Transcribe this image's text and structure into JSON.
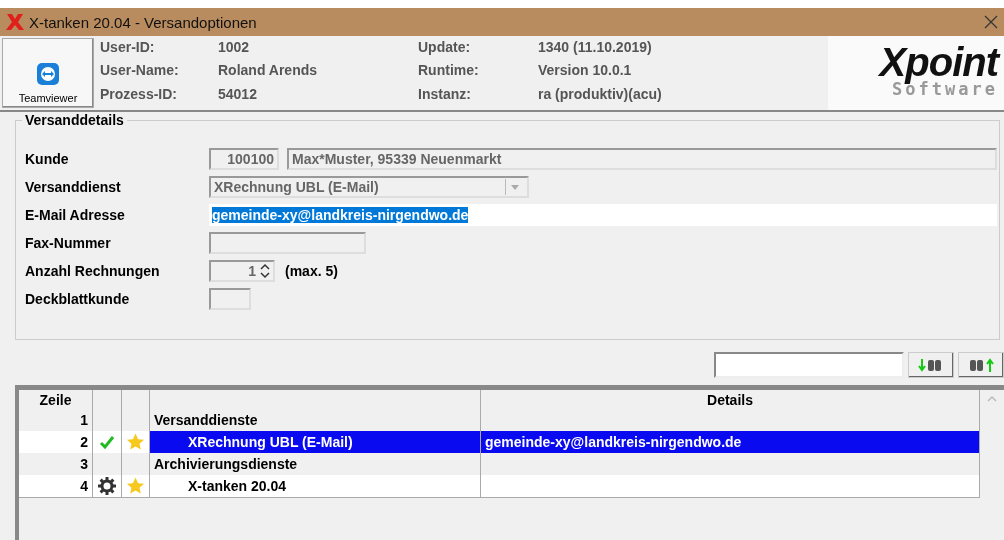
{
  "window": {
    "title": "X-tanken 20.04  - Versandoptionen"
  },
  "header": {
    "teamviewer_button": "Teamviewer",
    "info_left": [
      {
        "label": "User-ID:",
        "value": "1002"
      },
      {
        "label": "User-Name:",
        "value": "Roland Arends"
      },
      {
        "label": "Prozess-ID:",
        "value": "54012"
      }
    ],
    "info_right": [
      {
        "label": "Update:",
        "value": "1340 (11.10.2019)"
      },
      {
        "label": "Runtime:",
        "value": "Version 10.0.1"
      },
      {
        "label": "Instanz:",
        "value": "ra (produktiv)(acu)"
      }
    ],
    "logo": {
      "brand": "Xpoint",
      "tagline": "Software"
    }
  },
  "details": {
    "title": "Versanddetails",
    "rows": [
      {
        "label": "Kunde",
        "kind": "pair",
        "values": [
          "100100",
          "Max*Muster, 95339 Neuenmarkt"
        ]
      },
      {
        "label": "Versanddienst",
        "kind": "dropdown",
        "value": "XRechnung UBL (E-Mail)",
        "disabled": true
      },
      {
        "label": "E-Mail Adresse",
        "kind": "text",
        "value": "gemeinde-xy@landkreis-nirgendwo.de",
        "selected": true
      },
      {
        "label": "Fax-Nummer",
        "kind": "short"
      },
      {
        "label": "Anzahl Rechnungen",
        "kind": "spinner",
        "value": "1",
        "note": "(max. 5)"
      },
      {
        "label": "Deckblattkunde",
        "kind": "tiny"
      }
    ]
  },
  "table": {
    "columns": [
      "Zeile",
      "Details"
    ],
    "rows": [
      {
        "zeile": "1",
        "kind": "group",
        "checked": false,
        "gear": false,
        "starred": false,
        "name": "Versanddienste",
        "selected": false
      },
      {
        "zeile": "2",
        "kind": "item",
        "checked": true,
        "gear": false,
        "starred": true,
        "name": "XRechnung UBL (E-Mail)",
        "details": "gemeinde-xy@landkreis-nirgendwo.de",
        "selected": true
      },
      {
        "zeile": "3",
        "kind": "group",
        "checked": false,
        "gear": false,
        "starred": false,
        "name": "Archivierungsdienste",
        "selected": false
      },
      {
        "zeile": "4",
        "kind": "item",
        "checked": false,
        "gear": true,
        "starred": true,
        "name": "X-tanken 20.04",
        "selected": false
      }
    ]
  }
}
